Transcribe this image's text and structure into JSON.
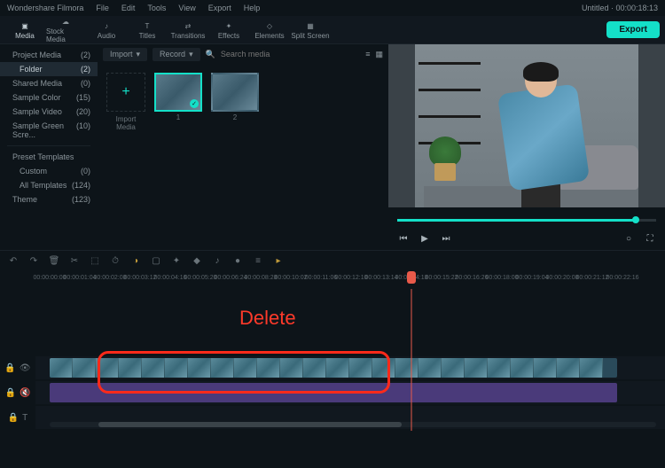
{
  "app": {
    "title": "Wondershare Filmora"
  },
  "menubar": [
    "File",
    "Edit",
    "Tools",
    "View",
    "Export",
    "Help"
  ],
  "titlebar_right": "Untitled · 00:00:18:13",
  "toolbar": {
    "items": [
      {
        "label": "Media"
      },
      {
        "label": "Stock Media"
      },
      {
        "label": "Audio"
      },
      {
        "label": "Titles"
      },
      {
        "label": "Transitions"
      },
      {
        "label": "Effects"
      },
      {
        "label": "Elements"
      },
      {
        "label": "Split Screen"
      }
    ],
    "export": "Export"
  },
  "sidebar": {
    "items": [
      {
        "label": "Project Media",
        "count": "(2)"
      },
      {
        "label": "Folder",
        "count": "(2)"
      },
      {
        "label": "Shared Media",
        "count": "(0)"
      },
      {
        "label": "Sample Color",
        "count": "(15)"
      },
      {
        "label": "Sample Video",
        "count": "(20)"
      },
      {
        "label": "Sample Green Scre...",
        "count": "(10)"
      }
    ],
    "presets_header": "Preset Templates",
    "presets": [
      {
        "label": "Custom",
        "count": "(0)"
      },
      {
        "label": "All Templates",
        "count": "(124)"
      },
      {
        "label": "Theme",
        "count": "(123)"
      }
    ]
  },
  "media": {
    "dropdown1": "Import",
    "dropdown2": "Record",
    "search_placeholder": "Search media",
    "import_label": "Import Media",
    "thumbs": [
      {
        "label": "1"
      },
      {
        "label": "2"
      }
    ]
  },
  "ruler": {
    "ticks": [
      "00:00:00:00",
      "00:00:01:04",
      "00:00:02:08",
      "00:00:03:12",
      "00:00:04:16",
      "00:00:05:20",
      "00:00:06:24",
      "00:00:08:28",
      "00:00:10:02",
      "00:00:11:06",
      "00:00:12:10",
      "00:00:13:14",
      "00:00:14:18",
      "00:00:15:22",
      "00:00:16:26",
      "00:00:18:00",
      "00:00:19:04",
      "00:00:20:08",
      "00:00:21:12",
      "00:00:22:16"
    ]
  },
  "annotation": {
    "delete": "Delete"
  }
}
